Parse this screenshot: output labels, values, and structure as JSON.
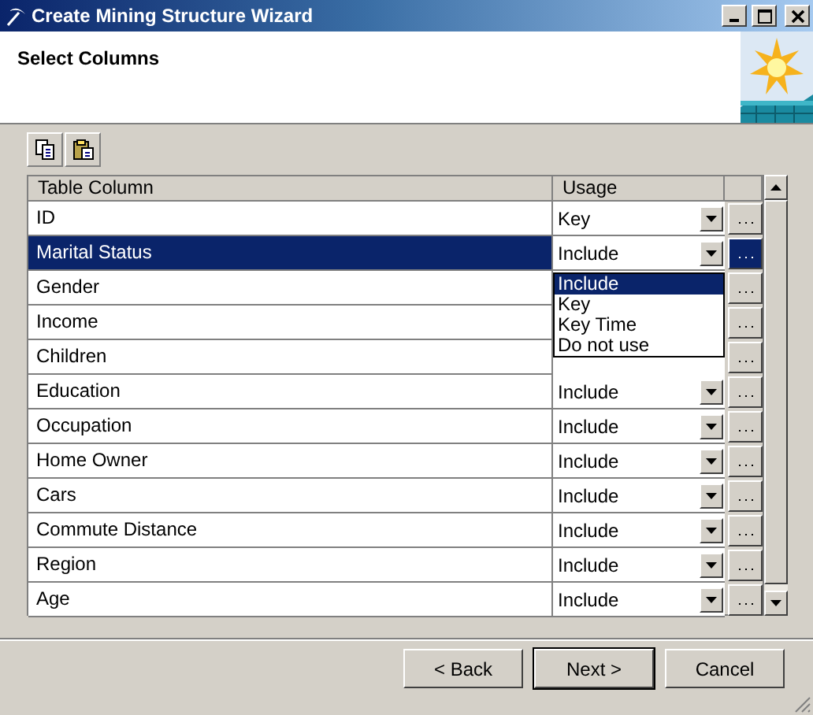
{
  "window": {
    "title": "Create Mining Structure Wizard"
  },
  "header": {
    "title": "Select Columns"
  },
  "table": {
    "columns": [
      "Table Column",
      "Usage"
    ],
    "rows": [
      {
        "name": "ID",
        "usage": "Key",
        "selected": false
      },
      {
        "name": "Marital Status",
        "usage": "Include",
        "selected": true
      },
      {
        "name": "Gender",
        "selected": false
      },
      {
        "name": "Income",
        "selected": false
      },
      {
        "name": "Children",
        "selected": false
      },
      {
        "name": "Education",
        "usage": "Include",
        "selected": false
      },
      {
        "name": "Occupation",
        "usage": "Include",
        "selected": false
      },
      {
        "name": "Home Owner",
        "usage": "Include",
        "selected": false
      },
      {
        "name": "Cars",
        "usage": "Include",
        "selected": false
      },
      {
        "name": "Commute Distance",
        "usage": "Include",
        "selected": false
      },
      {
        "name": "Region",
        "usage": "Include",
        "selected": false
      },
      {
        "name": "Age",
        "usage": "Include",
        "selected": false
      }
    ]
  },
  "dropdown": {
    "options": [
      {
        "label": "Include",
        "selected": true
      },
      {
        "label": "Key",
        "selected": false
      },
      {
        "label": "Key Time",
        "selected": false
      },
      {
        "label": "Do not use",
        "selected": false
      }
    ]
  },
  "buttons": [
    {
      "label": "< Back",
      "default": false
    },
    {
      "label": "Next >",
      "default": true
    },
    {
      "label": "Cancel",
      "default": false
    }
  ]
}
